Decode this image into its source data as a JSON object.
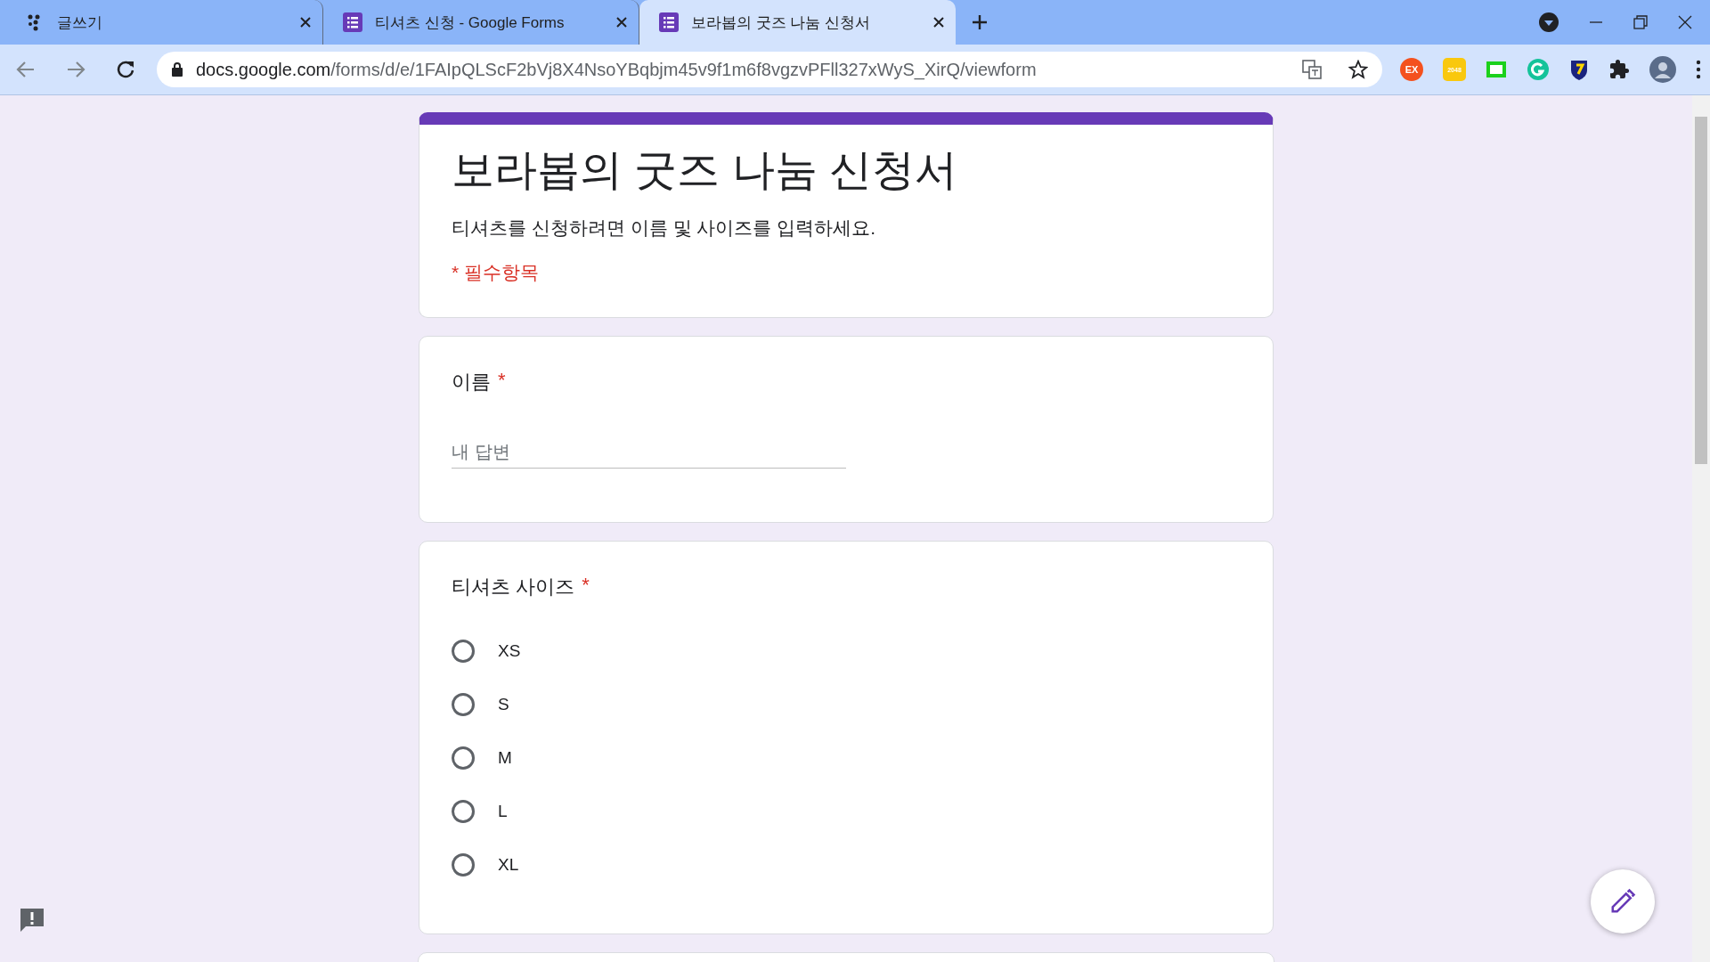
{
  "tabs": [
    {
      "title": "글쓰기",
      "kind": "compose",
      "selected": false
    },
    {
      "title": "티셔츠 신청 - Google Forms",
      "kind": "form",
      "selected": false
    },
    {
      "title": "보라봅의 굿즈 나눔 신청서",
      "kind": "form",
      "selected": true
    }
  ],
  "address_bar": {
    "url_host": "docs.google.com",
    "url_path": "/forms/d/e/1FAIpQLScF2bVj8X4NsoYBqbjm45v9f1m6f8vgzvPFll327xWyS_XirQ/viewform"
  },
  "extensions": [
    {
      "kind": "ex",
      "label": "EX"
    },
    {
      "kind": "game",
      "label": "2048"
    },
    {
      "kind": "n"
    },
    {
      "kind": "g"
    },
    {
      "kind": "shield"
    },
    {
      "kind": "puzzle"
    },
    {
      "kind": "avatar"
    }
  ],
  "form": {
    "title": "보라봅의 굿즈 나눔 신청서",
    "description": "티셔츠를 신청하려면 이름 및 사이즈를 입력하세요.",
    "required_note": "* 필수항목",
    "questions": [
      {
        "kind": "text",
        "title": "이름",
        "required_mark": "*",
        "placeholder": "내 답변"
      },
      {
        "kind": "radio",
        "title": "티셔츠 사이즈",
        "required_mark": "*",
        "options": [
          {
            "label": "XS",
            "selected": false
          },
          {
            "label": "S",
            "selected": false
          },
          {
            "label": "M",
            "selected": false
          },
          {
            "label": "L",
            "selected": false
          },
          {
            "label": "XL",
            "selected": false
          }
        ]
      }
    ]
  }
}
